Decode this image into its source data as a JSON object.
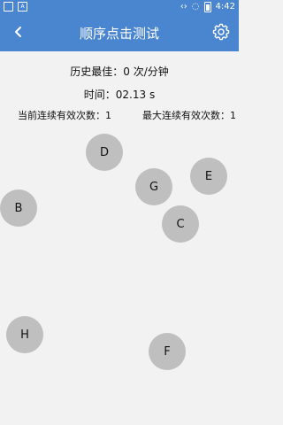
{
  "status_bar": {
    "time": "4:42",
    "icons": [
      "image-icon",
      "font-icon",
      "data-arrows-icon",
      "signal-icon",
      "battery-icon"
    ],
    "font_icon_label": "A"
  },
  "app_bar": {
    "title": "顺序点击测试",
    "color": "#4a86cf",
    "back_icon": "chevron-left-icon",
    "settings_icon": "gear-icon"
  },
  "stats": {
    "best_label": "历史最佳：0 次/分钟",
    "time_label": "时间：02.13 s",
    "current_streak_label": "当前连续有效次数：1",
    "max_streak_label": "最大连续有效次数：1"
  },
  "targets": [
    {
      "label": "D"
    },
    {
      "label": "G"
    },
    {
      "label": "E"
    },
    {
      "label": "B"
    },
    {
      "label": "C"
    },
    {
      "label": "H"
    },
    {
      "label": "F"
    }
  ]
}
